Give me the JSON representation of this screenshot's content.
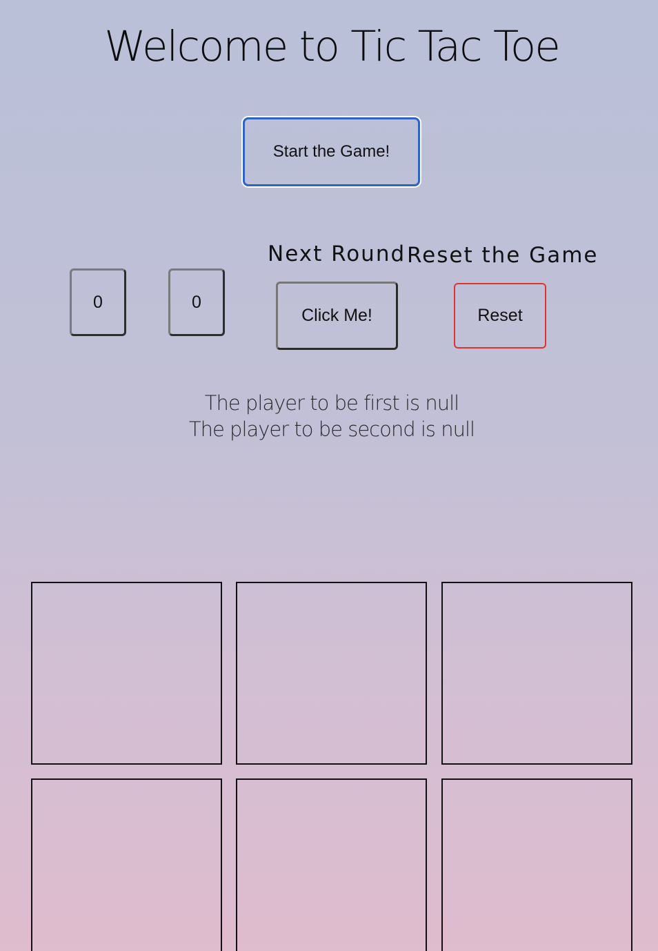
{
  "title": "Welcome to Tic Tac Toe",
  "start_button": {
    "label": "Start the Game!"
  },
  "scores": [
    "0",
    "0"
  ],
  "next_round": {
    "heading": "Next Round",
    "button_label": "Click Me!"
  },
  "reset_game": {
    "heading": "Reset the Game",
    "button_label": "Reset"
  },
  "players": {
    "first": "The player to be first is null",
    "second": "The player to be second is null"
  },
  "board": {
    "cells": [
      "",
      "",
      "",
      "",
      "",
      ""
    ]
  },
  "colors": {
    "start_border": "#2f63c4",
    "reset_border": "#e0332f"
  }
}
